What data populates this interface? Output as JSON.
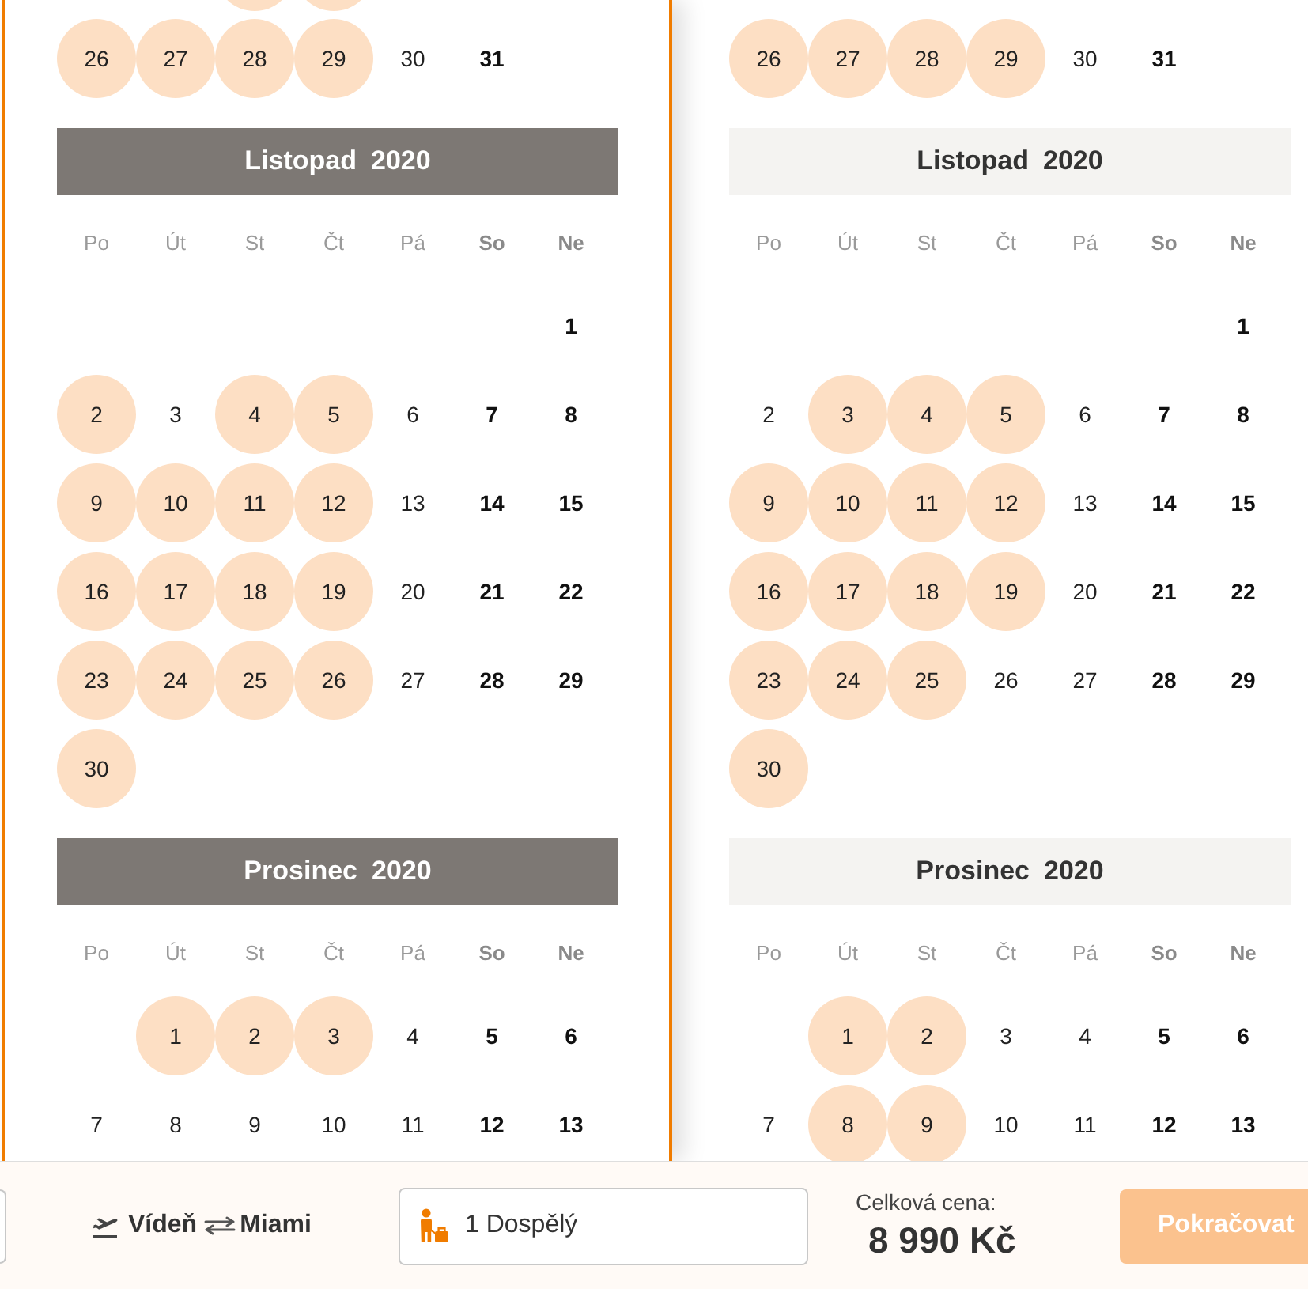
{
  "calendars": [
    {
      "selected": true,
      "months": [
        {
          "cut_off_week": [
            {
              "available": false
            },
            {
              "available": false
            },
            {
              "available": true
            },
            {
              "available": true
            },
            {
              "available": false
            },
            {
              "available": false
            },
            {
              "available": false
            }
          ],
          "weeks": [
            [
              {
                "day": "26",
                "available": true
              },
              {
                "day": "27",
                "available": true
              },
              {
                "day": "28",
                "available": true
              },
              {
                "day": "29",
                "available": true
              },
              {
                "day": "30",
                "available": false
              },
              {
                "day": "31",
                "available": false
              }
            ]
          ]
        },
        {
          "month": "Listopad",
          "year": "2020",
          "weekdays": [
            {
              "label": "Po",
              "weekend": false
            },
            {
              "label": "Út",
              "weekend": false
            },
            {
              "label": "St",
              "weekend": false
            },
            {
              "label": "Čt",
              "weekend": false
            },
            {
              "label": "Pá",
              "weekend": false
            },
            {
              "label": "So",
              "weekend": true
            },
            {
              "label": "Ne",
              "weekend": true
            }
          ],
          "weeks": [
            [
              {
                "day": "1",
                "available": false
              }
            ],
            [
              {
                "day": "2",
                "available": true
              },
              {
                "day": "3",
                "available": false
              },
              {
                "day": "4",
                "available": true
              },
              {
                "day": "5",
                "available": true
              },
              {
                "day": "6",
                "available": false
              },
              {
                "day": "7",
                "available": false
              },
              {
                "day": "8",
                "available": false
              }
            ],
            [
              {
                "day": "9",
                "available": true
              },
              {
                "day": "10",
                "available": true
              },
              {
                "day": "11",
                "available": true
              },
              {
                "day": "12",
                "available": true
              },
              {
                "day": "13",
                "available": false
              },
              {
                "day": "14",
                "available": false
              },
              {
                "day": "15",
                "available": false
              }
            ],
            [
              {
                "day": "16",
                "available": true
              },
              {
                "day": "17",
                "available": true
              },
              {
                "day": "18",
                "available": true
              },
              {
                "day": "19",
                "available": true
              },
              {
                "day": "20",
                "available": false
              },
              {
                "day": "21",
                "available": false
              },
              {
                "day": "22",
                "available": false
              }
            ],
            [
              {
                "day": "23",
                "available": true
              },
              {
                "day": "24",
                "available": true
              },
              {
                "day": "25",
                "available": true
              },
              {
                "day": "26",
                "available": true
              },
              {
                "day": "27",
                "available": false
              },
              {
                "day": "28",
                "available": false
              },
              {
                "day": "29",
                "available": false
              }
            ],
            [
              {
                "day": "30",
                "available": true
              }
            ]
          ]
        },
        {
          "month": "Prosinec",
          "year": "2020",
          "weekdays": [
            {
              "label": "Po",
              "weekend": false
            },
            {
              "label": "Út",
              "weekend": false
            },
            {
              "label": "St",
              "weekend": false
            },
            {
              "label": "Čt",
              "weekend": false
            },
            {
              "label": "Pá",
              "weekend": false
            },
            {
              "label": "So",
              "weekend": true
            },
            {
              "label": "Ne",
              "weekend": true
            }
          ],
          "weeks": [
            [
              {
                "day": "1",
                "available": true
              },
              {
                "day": "2",
                "available": true
              },
              {
                "day": "3",
                "available": true
              },
              {
                "day": "4",
                "available": false
              },
              {
                "day": "5",
                "available": false
              },
              {
                "day": "6",
                "available": false
              }
            ],
            [
              {
                "day": "7",
                "available": false
              },
              {
                "day": "8",
                "available": false
              },
              {
                "day": "9",
                "available": false
              },
              {
                "day": "10",
                "available": false
              },
              {
                "day": "11",
                "available": false
              },
              {
                "day": "12",
                "available": false
              },
              {
                "day": "13",
                "available": false
              }
            ]
          ]
        }
      ]
    },
    {
      "selected": false,
      "months": [
        {
          "weeks": [
            [
              {
                "day": "26",
                "available": true
              },
              {
                "day": "27",
                "available": true
              },
              {
                "day": "28",
                "available": true
              },
              {
                "day": "29",
                "available": true
              },
              {
                "day": "30",
                "available": false
              },
              {
                "day": "31",
                "available": false
              }
            ]
          ]
        },
        {
          "month": "Listopad",
          "year": "2020",
          "weekdays": [
            {
              "label": "Po",
              "weekend": false
            },
            {
              "label": "Út",
              "weekend": false
            },
            {
              "label": "St",
              "weekend": false
            },
            {
              "label": "Čt",
              "weekend": false
            },
            {
              "label": "Pá",
              "weekend": false
            },
            {
              "label": "So",
              "weekend": true
            },
            {
              "label": "Ne",
              "weekend": true
            }
          ],
          "weeks": [
            [
              {
                "day": "1",
                "available": false
              }
            ],
            [
              {
                "day": "2",
                "available": false
              },
              {
                "day": "3",
                "available": true
              },
              {
                "day": "4",
                "available": true
              },
              {
                "day": "5",
                "available": true
              },
              {
                "day": "6",
                "available": false
              },
              {
                "day": "7",
                "available": false
              },
              {
                "day": "8",
                "available": false
              }
            ],
            [
              {
                "day": "9",
                "available": true
              },
              {
                "day": "10",
                "available": true
              },
              {
                "day": "11",
                "available": true
              },
              {
                "day": "12",
                "available": true
              },
              {
                "day": "13",
                "available": false
              },
              {
                "day": "14",
                "available": false
              },
              {
                "day": "15",
                "available": false
              }
            ],
            [
              {
                "day": "16",
                "available": true
              },
              {
                "day": "17",
                "available": true
              },
              {
                "day": "18",
                "available": true
              },
              {
                "day": "19",
                "available": true
              },
              {
                "day": "20",
                "available": false
              },
              {
                "day": "21",
                "available": false
              },
              {
                "day": "22",
                "available": false
              }
            ],
            [
              {
                "day": "23",
                "available": true
              },
              {
                "day": "24",
                "available": true
              },
              {
                "day": "25",
                "available": true
              },
              {
                "day": "26",
                "available": false
              },
              {
                "day": "27",
                "available": false
              },
              {
                "day": "28",
                "available": false
              },
              {
                "day": "29",
                "available": false
              }
            ],
            [
              {
                "day": "30",
                "available": true
              }
            ]
          ]
        },
        {
          "month": "Prosinec",
          "year": "2020",
          "weekdays": [
            {
              "label": "Po",
              "weekend": false
            },
            {
              "label": "Út",
              "weekend": false
            },
            {
              "label": "St",
              "weekend": false
            },
            {
              "label": "Čt",
              "weekend": false
            },
            {
              "label": "Pá",
              "weekend": false
            },
            {
              "label": "So",
              "weekend": true
            },
            {
              "label": "Ne",
              "weekend": true
            }
          ],
          "weeks": [
            [
              {
                "day": "1",
                "available": true
              },
              {
                "day": "2",
                "available": true
              },
              {
                "day": "3",
                "available": false
              },
              {
                "day": "4",
                "available": false
              },
              {
                "day": "5",
                "available": false
              },
              {
                "day": "6",
                "available": false
              }
            ],
            [
              {
                "day": "7",
                "available": false
              },
              {
                "day": "8",
                "available": true
              },
              {
                "day": "9",
                "available": true
              },
              {
                "day": "10",
                "available": false
              },
              {
                "day": "11",
                "available": false
              },
              {
                "day": "12",
                "available": false
              },
              {
                "day": "13",
                "available": false
              }
            ]
          ]
        }
      ]
    }
  ],
  "route": {
    "from": "Vídeň",
    "to": "Miami"
  },
  "passengers": {
    "value": "1 Dospělý"
  },
  "price": {
    "label": "Celková cena:",
    "value": "8 990 Kč"
  },
  "continue_button": {
    "label": "Pokračovat",
    "disabled": true
  }
}
